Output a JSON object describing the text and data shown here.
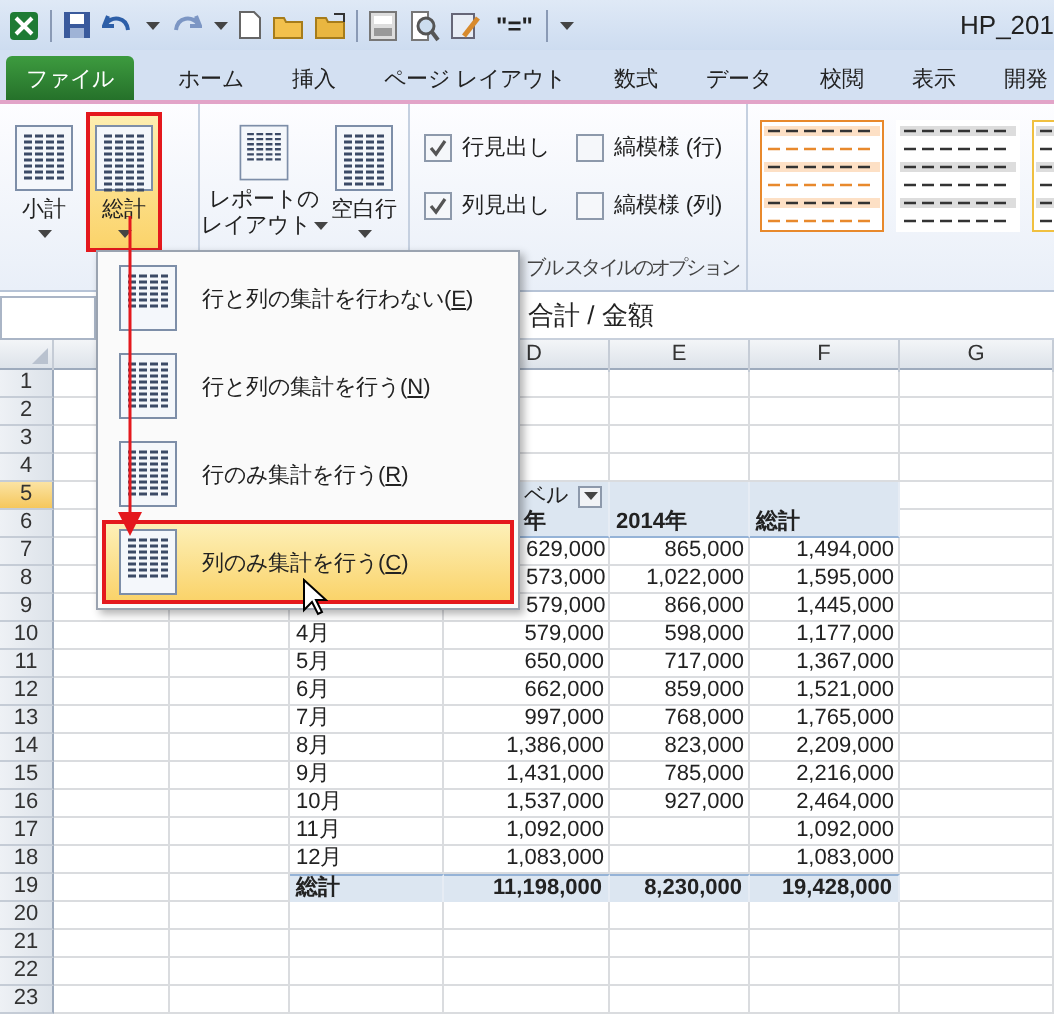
{
  "window": {
    "title": "HP_201",
    "formula_button": "\"=\""
  },
  "tabs": [
    {
      "label": "ファイル",
      "selected": true,
      "kind": "file"
    },
    {
      "label": "ホーム",
      "selected": false,
      "kind": "tab"
    },
    {
      "label": "挿入",
      "selected": false,
      "kind": "tab"
    },
    {
      "label": "ページ レイアウト",
      "selected": false,
      "kind": "tab"
    },
    {
      "label": "数式",
      "selected": false,
      "kind": "tab"
    },
    {
      "label": "データ",
      "selected": false,
      "kind": "tab"
    },
    {
      "label": "校閲",
      "selected": false,
      "kind": "tab"
    },
    {
      "label": "表示",
      "selected": false,
      "kind": "tab"
    },
    {
      "label": "開発",
      "selected": false,
      "kind": "tab"
    }
  ],
  "ribbon": {
    "buttons": [
      {
        "label": "小計",
        "selected": false
      },
      {
        "label": "総計",
        "selected": true
      },
      {
        "label_lines": [
          "レポートの",
          "レイアウト"
        ],
        "selected": false
      },
      {
        "label": "空白行",
        "selected": false
      }
    ],
    "checkboxes": [
      {
        "label": "行見出し",
        "checked": true
      },
      {
        "label": "縞模様 (行)",
        "checked": false
      },
      {
        "label": "列見出し",
        "checked": true
      },
      {
        "label": "縞模様 (列)",
        "checked": false
      }
    ],
    "group_label": "ブル スタイルのオプション"
  },
  "menu": {
    "items": [
      {
        "text": "行と列の集計を行わない(",
        "accel": "E",
        "after": ")",
        "selected": false
      },
      {
        "text": "行と列の集計を行う(",
        "accel": "N",
        "after": ")",
        "selected": false
      },
      {
        "text": "行のみ集計を行う(",
        "accel": "R",
        "after": ")",
        "selected": false
      },
      {
        "text": "列のみ集計を行う(",
        "accel": "C",
        "after": ")",
        "selected": true
      }
    ]
  },
  "formula_bar": {
    "value": "合計 / 金額"
  },
  "sheet": {
    "columns": [
      "D",
      "E",
      "F",
      "G"
    ],
    "rows": [
      {
        "number": "1",
        "selected": false,
        "kind": "empty"
      },
      {
        "number": "2",
        "selected": false,
        "kind": "empty"
      },
      {
        "number": "3",
        "selected": false,
        "kind": "empty"
      },
      {
        "number": "4",
        "selected": false,
        "kind": "empty"
      },
      {
        "number": "5",
        "selected": true,
        "kind": "filter",
        "d": "ベル"
      },
      {
        "number": "6",
        "selected": false,
        "kind": "header",
        "d": "年",
        "e": "2014年",
        "f": "総計"
      },
      {
        "number": "7",
        "selected": false,
        "kind": "data",
        "d": "629,000",
        "e": "865,000",
        "f": "1,494,000"
      },
      {
        "number": "8",
        "selected": false,
        "kind": "data",
        "d": "573,000",
        "e": "1,022,000",
        "f": "1,595,000"
      },
      {
        "number": "9",
        "selected": false,
        "kind": "data",
        "d": "579,000",
        "e": "866,000",
        "f": "1,445,000"
      },
      {
        "number": "10",
        "selected": false,
        "kind": "data",
        "c": "4月",
        "d": "579,000",
        "e": "598,000",
        "f": "1,177,000"
      },
      {
        "number": "11",
        "selected": false,
        "kind": "data",
        "c": "5月",
        "d": "650,000",
        "e": "717,000",
        "f": "1,367,000"
      },
      {
        "number": "12",
        "selected": false,
        "kind": "data",
        "c": "6月",
        "d": "662,000",
        "e": "859,000",
        "f": "1,521,000"
      },
      {
        "number": "13",
        "selected": false,
        "kind": "data",
        "c": "7月",
        "d": "997,000",
        "e": "768,000",
        "f": "1,765,000"
      },
      {
        "number": "14",
        "selected": false,
        "kind": "data",
        "c": "8月",
        "d": "1,386,000",
        "e": "823,000",
        "f": "2,209,000"
      },
      {
        "number": "15",
        "selected": false,
        "kind": "data",
        "c": "9月",
        "d": "1,431,000",
        "e": "785,000",
        "f": "2,216,000"
      },
      {
        "number": "16",
        "selected": false,
        "kind": "data",
        "c": "10月",
        "d": "1,537,000",
        "e": "927,000",
        "f": "2,464,000"
      },
      {
        "number": "17",
        "selected": false,
        "kind": "data",
        "c": "11月",
        "d": "1,092,000",
        "f": "1,092,000"
      },
      {
        "number": "18",
        "selected": false,
        "kind": "data",
        "c": "12月",
        "d": "1,083,000",
        "f": "1,083,000"
      },
      {
        "number": "19",
        "selected": false,
        "kind": "total",
        "c": "総計",
        "d": "11,198,000",
        "e": "8,230,000",
        "f": "19,428,000"
      },
      {
        "number": "20",
        "selected": false,
        "kind": "empty"
      },
      {
        "number": "21",
        "selected": false,
        "kind": "empty"
      },
      {
        "number": "22",
        "selected": false,
        "kind": "empty"
      },
      {
        "number": "23",
        "selected": false,
        "kind": "empty"
      }
    ]
  }
}
